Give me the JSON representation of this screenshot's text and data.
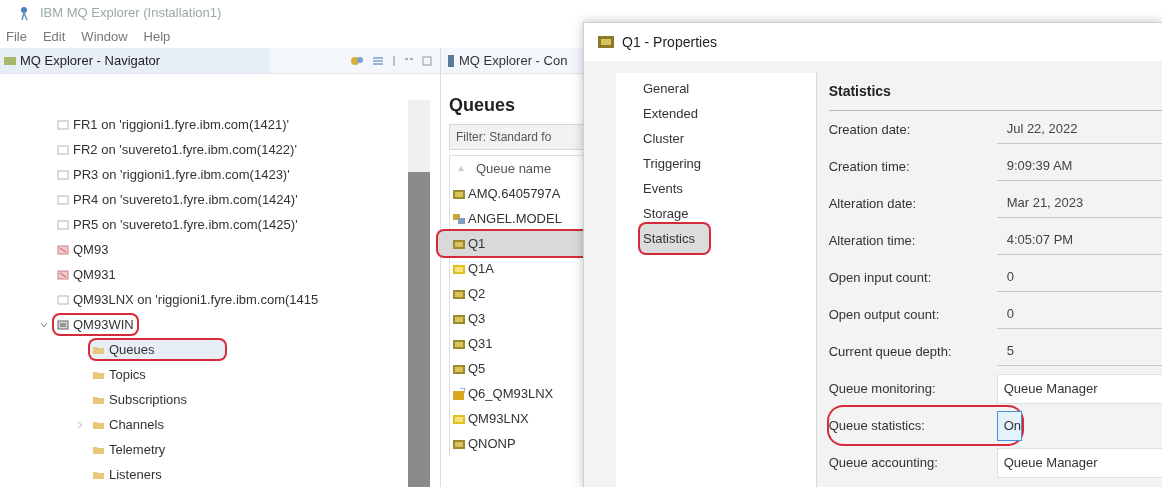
{
  "window": {
    "title": "IBM MQ Explorer (Installation1)"
  },
  "menu": [
    "File",
    "Edit",
    "Window",
    "Help"
  ],
  "navigator": {
    "title": "MQ Explorer - Navigator",
    "tree": [
      {
        "label": "FR1 on 'riggioni1.fyre.ibm.com(1421)'",
        "kind": "remote",
        "annotated": false,
        "selected": false
      },
      {
        "label": "FR2 on 'suvereto1.fyre.ibm.com(1422)'",
        "kind": "remote",
        "annotated": false,
        "selected": false
      },
      {
        "label": "PR3 on 'riggioni1.fyre.ibm.com(1423)'",
        "kind": "remote",
        "annotated": false,
        "selected": false
      },
      {
        "label": "PR4 on 'suvereto1.fyre.ibm.com(1424)'",
        "kind": "remote",
        "annotated": false,
        "selected": false
      },
      {
        "label": "PR5 on 'suvereto1.fyre.ibm.com(1425)'",
        "kind": "remote",
        "annotated": false,
        "selected": false
      },
      {
        "label": "QM93",
        "kind": "stopped",
        "annotated": false,
        "selected": false
      },
      {
        "label": "QM931",
        "kind": "stopped",
        "annotated": false,
        "selected": false
      },
      {
        "label": "QM93LNX on 'riggioni1.fyre.ibm.com(1415",
        "kind": "remote",
        "annotated": false,
        "selected": false
      },
      {
        "label": "QM93WIN",
        "kind": "running",
        "expanded": true,
        "annotated": true,
        "selected": false,
        "children": [
          {
            "label": "Queues",
            "kind": "folder",
            "annotated": true,
            "selected": true
          },
          {
            "label": "Topics",
            "kind": "folder",
            "annotated": false,
            "selected": false
          },
          {
            "label": "Subscriptions",
            "kind": "folder",
            "annotated": false,
            "selected": false
          },
          {
            "label": "Channels",
            "kind": "folder",
            "expanded": false,
            "annotated": false,
            "selected": false
          },
          {
            "label": "Telemetry",
            "kind": "folder",
            "annotated": false,
            "selected": false
          },
          {
            "label": "Listeners",
            "kind": "folder",
            "annotated": false,
            "selected": false
          }
        ]
      }
    ]
  },
  "content": {
    "tab": "MQ Explorer - Con",
    "heading": "Queues",
    "filter": "Filter: Standard fo",
    "column": "Queue name",
    "rows": [
      {
        "name": "AMQ.6405797A",
        "kind": "local",
        "selected": false,
        "annotated": false
      },
      {
        "name": "ANGEL.MODEL",
        "kind": "model",
        "selected": false,
        "annotated": false
      },
      {
        "name": "Q1",
        "kind": "local",
        "selected": true,
        "annotated": true
      },
      {
        "name": "Q1A",
        "kind": "alias",
        "selected": false,
        "annotated": false
      },
      {
        "name": "Q2",
        "kind": "local",
        "selected": false,
        "annotated": false
      },
      {
        "name": "Q3",
        "kind": "local",
        "selected": false,
        "annotated": false
      },
      {
        "name": "Q31",
        "kind": "local",
        "selected": false,
        "annotated": false
      },
      {
        "name": "Q5",
        "kind": "local",
        "selected": false,
        "annotated": false
      },
      {
        "name": "Q6_QM93LNX",
        "kind": "remote",
        "selected": false,
        "annotated": false
      },
      {
        "name": "QM93LNX",
        "kind": "alias",
        "selected": false,
        "annotated": false
      },
      {
        "name": "QNONP",
        "kind": "local",
        "selected": false,
        "annotated": false
      }
    ]
  },
  "dialog": {
    "title": "Q1 - Properties",
    "pages": [
      {
        "label": "General",
        "selected": false,
        "annotated": false
      },
      {
        "label": "Extended",
        "selected": false,
        "annotated": false
      },
      {
        "label": "Cluster",
        "selected": false,
        "annotated": false
      },
      {
        "label": "Triggering",
        "selected": false,
        "annotated": false
      },
      {
        "label": "Events",
        "selected": false,
        "annotated": false
      },
      {
        "label": "Storage",
        "selected": false,
        "annotated": false
      },
      {
        "label": "Statistics",
        "selected": true,
        "annotated": true
      }
    ],
    "section": "Statistics",
    "fields": [
      {
        "label": "Creation date:",
        "value": "Jul 22, 2022",
        "kind": "readonly",
        "annotated": false
      },
      {
        "label": "Creation time:",
        "value": "9:09:39 AM",
        "kind": "readonly",
        "annotated": false
      },
      {
        "label": "Alteration date:",
        "value": "Mar 21, 2023",
        "kind": "readonly",
        "annotated": false
      },
      {
        "label": "Alteration time:",
        "value": "4:05:07 PM",
        "kind": "readonly",
        "annotated": false
      },
      {
        "label": "Open input count:",
        "value": "0",
        "kind": "readonly",
        "annotated": false
      },
      {
        "label": "Open output count:",
        "value": "0",
        "kind": "readonly",
        "annotated": false
      },
      {
        "label": "Current queue depth:",
        "value": "5",
        "kind": "readonly",
        "annotated": false
      },
      {
        "label": "Queue monitoring:",
        "value": "Queue Manager",
        "kind": "combo",
        "focused": false,
        "annotated": false
      },
      {
        "label": "Queue statistics:",
        "value": "On",
        "kind": "combo",
        "focused": true,
        "annotated": true
      },
      {
        "label": "Queue accounting:",
        "value": "Queue Manager",
        "kind": "combo",
        "focused": false,
        "annotated": false
      }
    ]
  }
}
